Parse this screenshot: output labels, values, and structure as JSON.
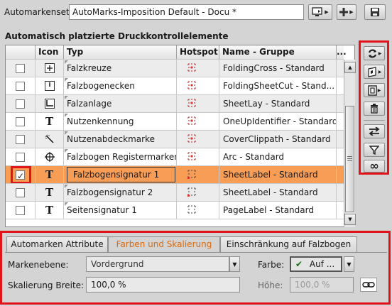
{
  "top": {
    "set_label": "Automarkenset:",
    "set_value": "AutoMarks-Imposition Default - Docu *"
  },
  "section_title": "Automatisch platzierte Druckkontrollelemente",
  "table": {
    "columns": [
      "",
      "Icon",
      "Typ",
      "Hotspot",
      "Name - Gruppe",
      "..."
    ],
    "rows": [
      {
        "checked": false,
        "icon": "cross-icon",
        "typ": "Falzkreuze",
        "name": "FoldingCross - Standard"
      },
      {
        "checked": false,
        "icon": "fold-corner-icon",
        "typ": "Falzbogenecken",
        "name": "FoldingSheetCut - Stand..."
      },
      {
        "checked": false,
        "icon": "sheet-lay-icon",
        "typ": "Falzanlage",
        "name": "SheetLay - Standard"
      },
      {
        "checked": false,
        "icon": "text-t-icon",
        "typ": "Nutzenkennung",
        "name": "OneUpIdentifier - Standard"
      },
      {
        "checked": false,
        "icon": "wand-icon",
        "typ": "Nutzenabdeckmarke",
        "name": "CoverClippath - Standard"
      },
      {
        "checked": false,
        "icon": "register-mark-icon",
        "typ": "Falzbogen Registermarken",
        "name": "Arc - Standard"
      },
      {
        "checked": true,
        "icon": "text-t-icon",
        "typ": "Falzbogensignatur 1",
        "name": "SheetLabel - Standard",
        "selected": true
      },
      {
        "checked": false,
        "icon": "text-t-icon",
        "typ": "Falzbogensignatur 2",
        "name": "SheetLabel - Standard"
      },
      {
        "checked": false,
        "icon": "text-t-icon",
        "typ": "Seitensignatur 1",
        "name": "PageLabel - Standard"
      }
    ]
  },
  "tabs": [
    "Automarken Attribute",
    "Farben und Skalierung",
    "Einschränkung auf Falzbogen"
  ],
  "form": {
    "markenebene_label": "Markenebene:",
    "markenebene_value": "Vordergrund",
    "farbe_label": "Farbe:",
    "farbe_value": "Auf ...",
    "skalierung_label": "Skalierung Breite:",
    "skalierung_value": "100,0 %",
    "hoehe_label": "Höhe:",
    "hoehe_value": "100,0 %"
  },
  "colors": {
    "highlight": "#e0141a",
    "selected_row": "#f79d55",
    "active_tab_text": "#d96a10"
  }
}
